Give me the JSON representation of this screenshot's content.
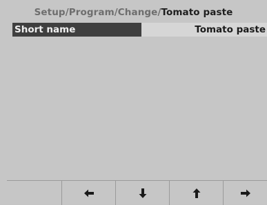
{
  "breadcrumb": {
    "segments": [
      "Setup",
      "Program",
      "Change"
    ],
    "separator": "/",
    "current": "Tomato paste"
  },
  "field": {
    "label": "Short name",
    "value": "Tomato paste"
  },
  "softkeys": [
    {
      "icon": "blank"
    },
    {
      "icon": "arrow-left-icon"
    },
    {
      "icon": "arrow-down-icon"
    },
    {
      "icon": "arrow-up-icon"
    },
    {
      "icon": "arrow-right-icon"
    }
  ],
  "colors": {
    "background": "#c6c6c6",
    "label_bg": "#3f3f3f",
    "value_bg": "#d6d6d6"
  }
}
